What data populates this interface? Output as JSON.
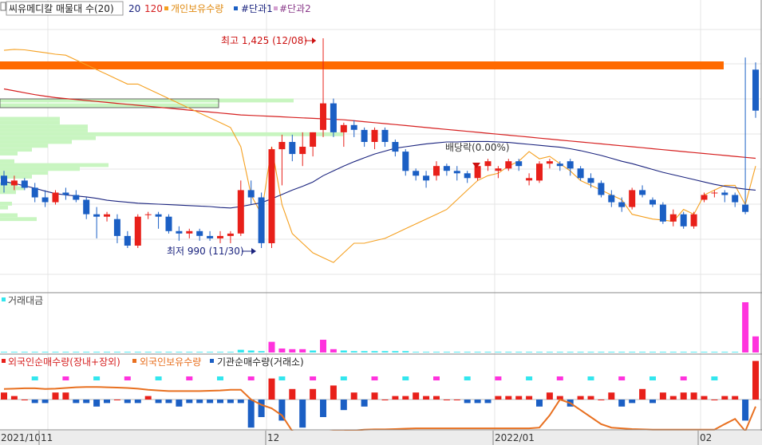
{
  "legend_top": {
    "name": "씨유메디칼 매물대 수(20)",
    "ma1": "20",
    "ma2": "120",
    "s1": "개인보유수량",
    "s2": "#단과1",
    "s3": "#단과2"
  },
  "legend_volume": {
    "name": "거래대금"
  },
  "legend_flow": {
    "s1": "외국인순매수량(장내+장외)",
    "s2": "외국인보유수량",
    "s3": "기관순매수량(거래소)"
  },
  "annotations": {
    "high": "최고 1,425 (12/08)",
    "low": "최저 990 (11/30)",
    "dividend": "배당락(0.00%)"
  },
  "x_labels": [
    "2021/10",
    "11",
    "12",
    "2022/01",
    "02"
  ],
  "colors": {
    "up": "#e8201a",
    "down": "#1b5fc4",
    "ma20": "#1a237e",
    "ma120": "#d62020",
    "individual": "#f5a020",
    "volume_pink": "#ff33dd",
    "volume_cyan": "#33e6ee",
    "foreign_hold": "#e87020",
    "profile": "#c8f5c0",
    "band": "#ff6a00"
  },
  "chart_data": {
    "type": "candlestick",
    "candles": [
      [
        1140,
        1150,
        1105,
        1120
      ],
      [
        1120,
        1140,
        1110,
        1130
      ],
      [
        1130,
        1135,
        1110,
        1115
      ],
      [
        1115,
        1125,
        1085,
        1095
      ],
      [
        1095,
        1110,
        1075,
        1085
      ],
      [
        1085,
        1110,
        1080,
        1105
      ],
      [
        1105,
        1115,
        1090,
        1100
      ],
      [
        1100,
        1110,
        1085,
        1090
      ],
      [
        1090,
        1095,
        1050,
        1060
      ],
      [
        1060,
        1075,
        1010,
        1055
      ],
      [
        1055,
        1065,
        1045,
        1060
      ],
      [
        1050,
        1060,
        1000,
        1015
      ],
      [
        1015,
        1025,
        990,
        995
      ],
      [
        995,
        1060,
        990,
        1055
      ],
      [
        1060,
        1065,
        1050,
        1060
      ],
      [
        1060,
        1065,
        1030,
        1055
      ],
      [
        1055,
        1060,
        1020,
        1025
      ],
      [
        1025,
        1035,
        1005,
        1020
      ],
      [
        1020,
        1030,
        1010,
        1025
      ],
      [
        1025,
        1030,
        1005,
        1015
      ],
      [
        1015,
        1025,
        1005,
        1010
      ],
      [
        1010,
        1025,
        1000,
        1015
      ],
      [
        1015,
        1025,
        1000,
        1020
      ],
      [
        1020,
        1130,
        1015,
        1110
      ],
      [
        1110,
        1130,
        1080,
        1095
      ],
      [
        1095,
        1105,
        990,
        1000
      ],
      [
        1000,
        1200,
        990,
        1195
      ],
      [
        1195,
        1225,
        1120,
        1210
      ],
      [
        1210,
        1225,
        1170,
        1185
      ],
      [
        1185,
        1230,
        1160,
        1200
      ],
      [
        1200,
        1230,
        1180,
        1230
      ],
      [
        1235,
        1425,
        1220,
        1290
      ],
      [
        1290,
        1300,
        1220,
        1230
      ],
      [
        1230,
        1250,
        1200,
        1245
      ],
      [
        1245,
        1255,
        1220,
        1235
      ],
      [
        1235,
        1240,
        1200,
        1210
      ],
      [
        1210,
        1240,
        1195,
        1235
      ],
      [
        1235,
        1240,
        1200,
        1210
      ],
      [
        1210,
        1215,
        1180,
        1190
      ],
      [
        1190,
        1195,
        1140,
        1150
      ],
      [
        1150,
        1155,
        1130,
        1140
      ],
      [
        1140,
        1150,
        1115,
        1130
      ],
      [
        1140,
        1170,
        1130,
        1160
      ],
      [
        1160,
        1165,
        1140,
        1150
      ],
      [
        1150,
        1160,
        1130,
        1145
      ],
      [
        1145,
        1150,
        1125,
        1135
      ],
      [
        1135,
        1165,
        1130,
        1160
      ],
      [
        1160,
        1175,
        1150,
        1170
      ],
      [
        1150,
        1160,
        1135,
        1155
      ],
      [
        1155,
        1175,
        1150,
        1170
      ],
      [
        1170,
        1175,
        1150,
        1160
      ],
      [
        1130,
        1145,
        1120,
        1135
      ],
      [
        1130,
        1170,
        1125,
        1165
      ],
      [
        1165,
        1175,
        1155,
        1170
      ],
      [
        1165,
        1170,
        1150,
        1160
      ],
      [
        1170,
        1175,
        1140,
        1155
      ],
      [
        1155,
        1160,
        1130,
        1135
      ],
      [
        1135,
        1145,
        1115,
        1125
      ],
      [
        1125,
        1130,
        1095,
        1100
      ],
      [
        1100,
        1110,
        1075,
        1085
      ],
      [
        1085,
        1095,
        1065,
        1075
      ],
      [
        1075,
        1115,
        1070,
        1110
      ],
      [
        1110,
        1120,
        1095,
        1100
      ],
      [
        1090,
        1095,
        1075,
        1080
      ],
      [
        1080,
        1085,
        1040,
        1045
      ],
      [
        1045,
        1070,
        1035,
        1060
      ],
      [
        1060,
        1065,
        1030,
        1035
      ],
      [
        1035,
        1065,
        1030,
        1060
      ],
      [
        1090,
        1105,
        1085,
        1100
      ],
      [
        1105,
        1110,
        1095,
        1105
      ],
      [
        1105,
        1110,
        1085,
        1100
      ],
      [
        1100,
        1105,
        1075,
        1085
      ],
      [
        1080,
        1385,
        1060,
        1065
      ],
      [
        1360,
        1375,
        1260,
        1275
      ]
    ],
    "ma20": [
      1128,
      1124,
      1119,
      1114,
      1108,
      1103,
      1100,
      1098,
      1096,
      1093,
      1089,
      1087,
      1085,
      1083,
      1082,
      1081,
      1080,
      1079,
      1078,
      1077,
      1076,
      1074,
      1073,
      1076,
      1080,
      1084,
      1092,
      1101,
      1110,
      1118,
      1127,
      1140,
      1150,
      1160,
      1169,
      1177,
      1185,
      1191,
      1197,
      1200,
      1203,
      1206,
      1208,
      1210,
      1210,
      1211,
      1211,
      1211,
      1210,
      1209,
      1207,
      1205,
      1203,
      1201,
      1199,
      1196,
      1192,
      1187,
      1182,
      1176,
      1170,
      1165,
      1159,
      1153,
      1147,
      1142,
      1137,
      1132,
      1127,
      1122,
      1118,
      1115,
      1112,
      1110
    ],
    "ma120": [
      1320,
      1316,
      1312,
      1308,
      1305,
      1302,
      1300,
      1298,
      1296,
      1294,
      1292,
      1290,
      1288,
      1286,
      1284,
      1282,
      1280,
      1278,
      1276,
      1274,
      1272,
      1270,
      1268,
      1266,
      1265,
      1264,
      1263,
      1262,
      1261,
      1260,
      1259,
      1258,
      1257,
      1256,
      1254,
      1252,
      1250,
      1248,
      1246,
      1244,
      1242,
      1240,
      1238,
      1236,
      1234,
      1232,
      1230,
      1228,
      1226,
      1224,
      1222,
      1220,
      1218,
      1216,
      1214,
      1212,
      1210,
      1208,
      1206,
      1204,
      1202,
      1200,
      1198,
      1196,
      1194,
      1192,
      1190,
      1188,
      1186,
      1184,
      1182,
      1180,
      1178,
      1176
    ],
    "individual": [
      1400,
      1402,
      1401,
      1398,
      1395,
      1392,
      1390,
      1380,
      1370,
      1360,
      1350,
      1340,
      1330,
      1330,
      1320,
      1310,
      1300,
      1290,
      1280,
      1270,
      1260,
      1250,
      1240,
      1200,
      1100,
      1060,
      1200,
      1080,
      1020,
      1000,
      980,
      970,
      960,
      980,
      1000,
      1000,
      1005,
      1010,
      1020,
      1030,
      1040,
      1050,
      1060,
      1070,
      1090,
      1110,
      1130,
      1140,
      1145,
      1160,
      1170,
      1190,
      1175,
      1180,
      1165,
      1150,
      1130,
      1120,
      1110,
      1100,
      1090,
      1060,
      1055,
      1050,
      1048,
      1045,
      1070,
      1060,
      1100,
      1110,
      1120,
      1120,
      1080,
      1160
    ],
    "volume": [
      1,
      1,
      1,
      1,
      1,
      1,
      1,
      1,
      1,
      1,
      1,
      1,
      1,
      1,
      1,
      1,
      1,
      1,
      1,
      1,
      1,
      1,
      1,
      4,
      3,
      2,
      16,
      6,
      5,
      5,
      3,
      19,
      5,
      3,
      2,
      2,
      2,
      2,
      2,
      2,
      1,
      1,
      1,
      1,
      1,
      1,
      1,
      1,
      1,
      1,
      1,
      1,
      1,
      1,
      1,
      1,
      1,
      1,
      1,
      1,
      1,
      1,
      1,
      1,
      1,
      1,
      1,
      1,
      1,
      1,
      1,
      1,
      75,
      24
    ],
    "foreign_net": [
      2,
      1,
      0,
      -1,
      -1,
      2,
      2,
      -1,
      -1,
      -2,
      -1,
      0,
      -1,
      -1,
      1,
      -1,
      -1,
      -2,
      -1,
      -1,
      -1,
      -1,
      -1,
      -1,
      -8,
      -5,
      6,
      -6,
      3,
      -8,
      3,
      -5,
      4,
      -3,
      2,
      -2,
      2,
      0,
      1,
      1,
      2,
      1,
      1,
      0,
      0,
      -1,
      -1,
      -1,
      1,
      1,
      1,
      1,
      -2,
      2,
      1,
      -2,
      1,
      1,
      0,
      2,
      -2,
      -1,
      3,
      -1,
      2,
      1,
      2,
      2,
      1,
      0,
      1,
      1,
      -6,
      11
    ],
    "foreign_hold": [
      3.0,
      3.1,
      3.2,
      3.2,
      3.0,
      3.1,
      3.3,
      3.5,
      3.6,
      3.6,
      3.5,
      3.4,
      3.3,
      3.1,
      2.8,
      2.6,
      2.4,
      2.4,
      2.4,
      2.4,
      2.5,
      2.6,
      2.8,
      2.8,
      0,
      -1.5,
      -2.5,
      -4.5,
      -9,
      -9.5,
      -9.5,
      -9.2,
      -9,
      -9,
      -8.8,
      -8.6,
      -8.5,
      -8.5,
      -8.4,
      -8.3,
      -8.2,
      -8.2,
      -8.2,
      -8.2,
      -8.2,
      -8.2,
      -8.2,
      -8.2,
      -8.2,
      -8.2,
      -8.2,
      -8.2,
      -8.0,
      -4.5,
      0,
      -1,
      -3,
      -5,
      -7,
      -8,
      -8.2,
      -8.4,
      -8.5,
      -8.6,
      -8.6,
      -8.6,
      -8.6,
      -8.6,
      -8.6,
      -8.6,
      -7,
      -5.5,
      -9,
      -2
    ],
    "x_ticks": [
      "2021/10",
      "11",
      "12",
      "2022/01",
      "02"
    ],
    "price_high": "1,425",
    "price_low": "990"
  }
}
